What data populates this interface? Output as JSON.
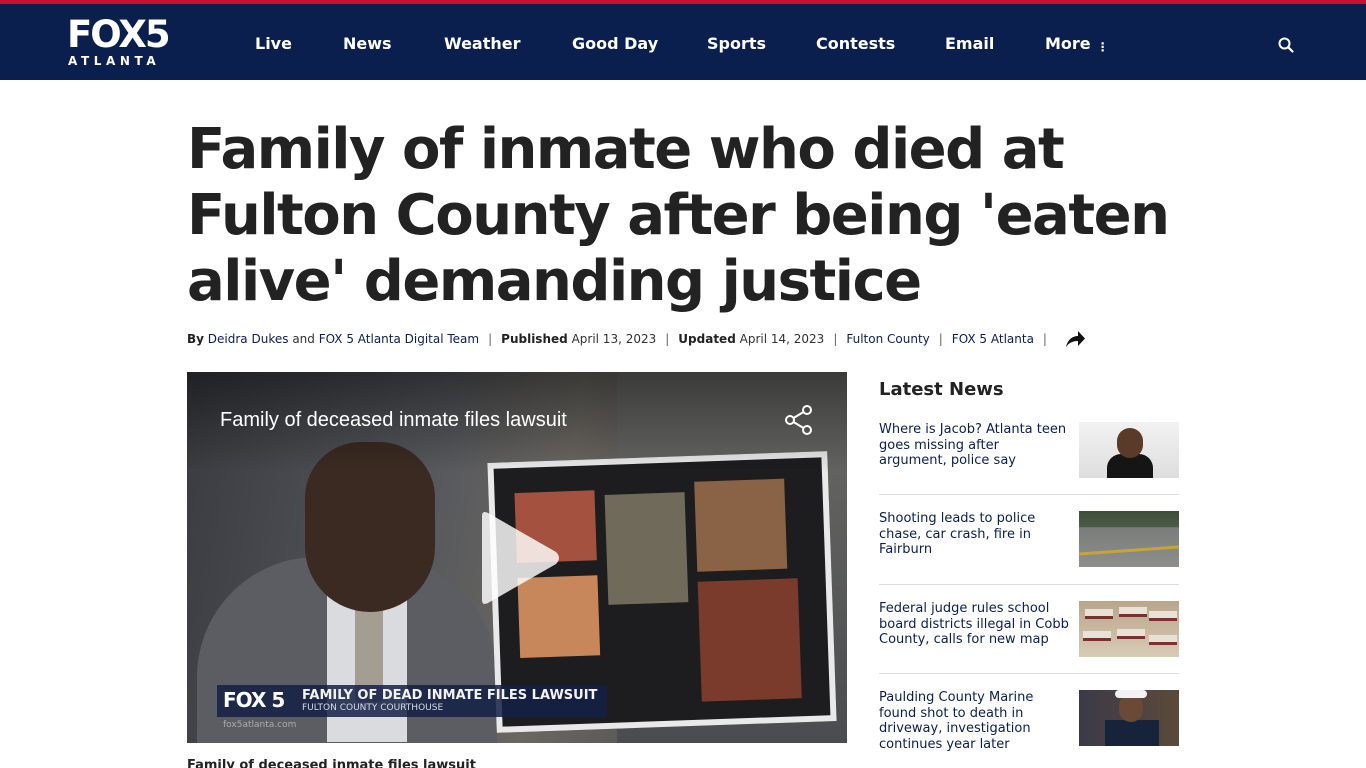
{
  "brand": {
    "logo_top": "FOX5",
    "logo_bottom": "ATLANTA"
  },
  "nav": {
    "items": [
      "Live",
      "News",
      "Weather",
      "Good Day",
      "Sports",
      "Contests",
      "Email",
      "More"
    ],
    "more_icon": "vertical-dots-icon",
    "search_icon": "search-icon"
  },
  "article": {
    "headline": "Family of inmate who died at Fulton County after being 'eaten alive' demanding justice",
    "byline": {
      "by_label": "By",
      "author_1": "Deidra Dukes",
      "and": "and",
      "author_2": "FOX 5 Atlanta Digital Team",
      "published_label": "Published",
      "published_date": "April 13, 2023",
      "updated_label": "Updated",
      "updated_date": "April 14, 2023",
      "tag_1": "Fulton County",
      "tag_2": "FOX 5 Atlanta",
      "share_icon": "share-arrow-icon"
    },
    "video": {
      "title": "Family of deceased inmate files lawsuit",
      "lower_third_logo": "FOX 5",
      "lower_third_main": "FAMILY OF DEAD INMATE FILES LAWSUIT",
      "lower_third_sub": "FULTON COUNTY COURTHOUSE",
      "lower_third_url": "fox5atlanta.com"
    },
    "caption": "Family of deceased inmate files lawsuit"
  },
  "sidebar": {
    "title": "Latest News",
    "items": [
      {
        "headline": "Where is Jacob? Atlanta teen goes missing after argument, police say"
      },
      {
        "headline": "Shooting leads to police chase, car crash, fire in Fairburn"
      },
      {
        "headline": "Federal judge rules school board districts illegal in Cobb County, calls for new map"
      },
      {
        "headline": "Paulding County Marine found shot to death in driveway, investigation continues year later"
      }
    ]
  },
  "colors": {
    "navbar": "#0b1f4f",
    "accent_red": "#c8102e",
    "link": "#0b1f4f"
  }
}
